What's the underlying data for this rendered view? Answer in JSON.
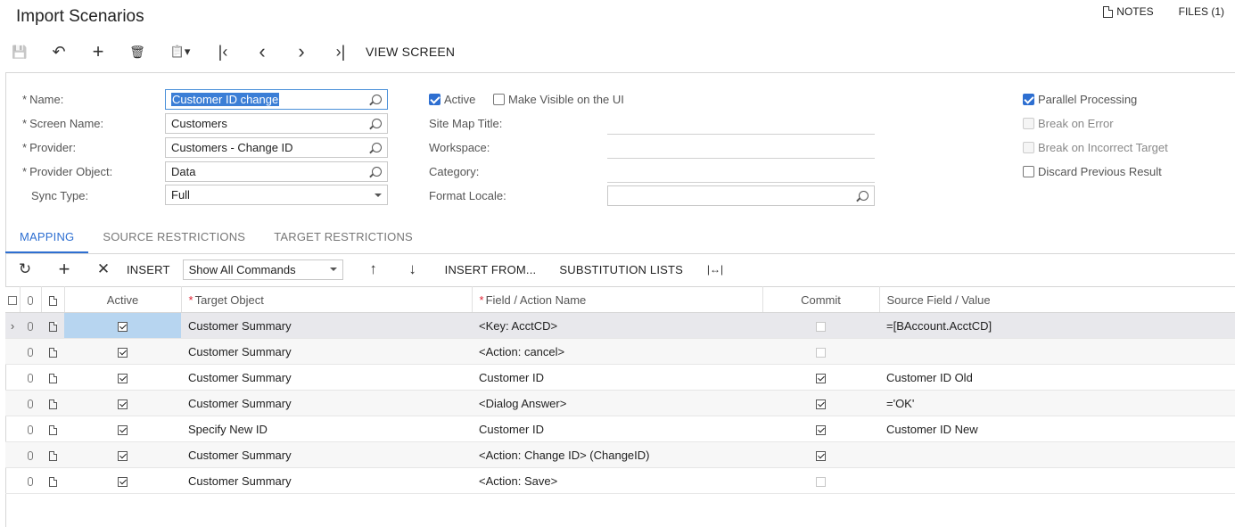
{
  "header": {
    "title": "Import Scenarios",
    "notes_label": "NOTES",
    "files_label": "FILES (1)"
  },
  "toolbar": {
    "save_icon": "💾",
    "undo_icon": "↶",
    "add_icon": "+",
    "delete_icon": "🗑",
    "clipboard_icon": "📋▾",
    "first_icon": "|‹",
    "prev_icon": "‹",
    "next_icon": "›",
    "last_icon": "›|",
    "view_screen_label": "VIEW SCREEN"
  },
  "form": {
    "name_label": "Name:",
    "name_value": "Customer ID change",
    "screen_name_label": "Screen Name:",
    "screen_name_value": "Customers",
    "provider_label": "Provider:",
    "provider_value": "Customers - Change ID",
    "provider_object_label": "Provider Object:",
    "provider_object_value": "Data",
    "sync_type_label": "Sync Type:",
    "sync_type_value": "Full",
    "active_label": "Active",
    "active_checked": true,
    "make_visible_label": "Make Visible on the UI",
    "make_visible_checked": false,
    "site_map_title_label": "Site Map Title:",
    "workspace_label": "Workspace:",
    "category_label": "Category:",
    "format_locale_label": "Format Locale:",
    "format_locale_value": "",
    "parallel_processing_label": "Parallel Processing",
    "parallel_processing_checked": true,
    "break_on_error_label": "Break on Error",
    "break_on_incorrect_target_label": "Break on Incorrect Target",
    "discard_previous_result_label": "Discard Previous Result"
  },
  "tabs": [
    {
      "label": "MAPPING",
      "active": true
    },
    {
      "label": "SOURCE RESTRICTIONS",
      "active": false
    },
    {
      "label": "TARGET RESTRICTIONS",
      "active": false
    }
  ],
  "grid_toolbar": {
    "refresh_icon": "↻",
    "add_icon": "+",
    "remove_icon": "✕",
    "insert_label": "INSERT",
    "commands_select_value": "Show All Commands",
    "up_icon": "↑",
    "down_icon": "↓",
    "insert_from_label": "INSERT FROM...",
    "substitution_lists_label": "SUBSTITUTION LISTS",
    "fit_icon": "|↔|"
  },
  "grid": {
    "columns": {
      "active": "Active",
      "target_object": "Target Object",
      "field_action": "Field / Action Name",
      "commit": "Commit",
      "source_field": "Source Field / Value"
    },
    "rows": [
      {
        "active": true,
        "target_object": "Customer Summary",
        "field_action": "<Key: AcctCD>",
        "commit": false,
        "source_field": "=[BAccount.AcctCD]"
      },
      {
        "active": true,
        "target_object": "Customer Summary",
        "field_action": "<Action: cancel>",
        "commit": false,
        "source_field": ""
      },
      {
        "active": true,
        "target_object": "Customer Summary",
        "field_action": "Customer ID",
        "commit": true,
        "source_field": "Customer ID Old"
      },
      {
        "active": true,
        "target_object": "Customer Summary",
        "field_action": "<Dialog Answer>",
        "commit": true,
        "source_field": "='OK'"
      },
      {
        "active": true,
        "target_object": "Specify New ID",
        "field_action": "Customer ID",
        "commit": true,
        "source_field": "Customer ID New"
      },
      {
        "active": true,
        "target_object": "Customer Summary",
        "field_action": "<Action: Change ID> (ChangeID)",
        "commit": true,
        "source_field": ""
      },
      {
        "active": true,
        "target_object": "Customer Summary",
        "field_action": "<Action: Save>",
        "commit": false,
        "source_field": ""
      }
    ]
  }
}
